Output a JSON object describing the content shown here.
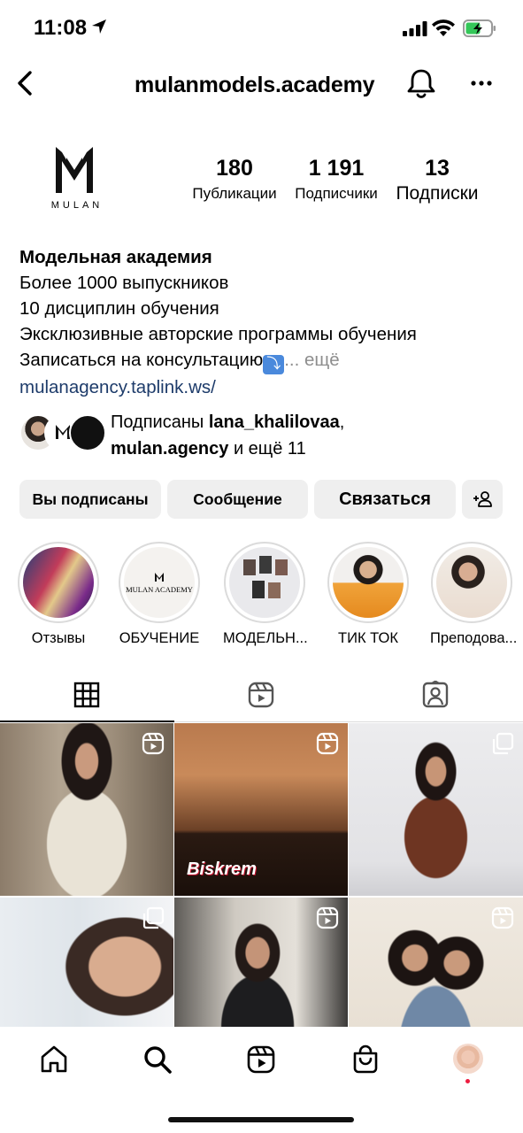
{
  "status_bar": {
    "time": "11:08"
  },
  "header": {
    "username": "mulanmodels.academy"
  },
  "avatar": {
    "logo_text": "MULAN"
  },
  "stats": [
    {
      "value": "180",
      "label": "Публикации"
    },
    {
      "value": "1 191",
      "label": "Подписчики"
    },
    {
      "value": "13",
      "label": "Подписки"
    }
  ],
  "bio": {
    "name": "Модельная академия",
    "lines": [
      "Более 1000 выпускников",
      "10 дисциплин обучения",
      "Эксклюзивные авторские программы обучения"
    ],
    "last_line": "Записаться на консультацию",
    "more": "... ещё",
    "link": "mulanagency.taplink.ws/"
  },
  "followed_by": {
    "prefix": "Подписаны ",
    "user1": "lana_khalilovaa",
    "sep": ",",
    "user2": "mulan.agency",
    "suffix": " и ещё 11"
  },
  "buttons": {
    "following": "Вы подписаны",
    "message": "Сообщение",
    "contact": "Связаться"
  },
  "highlights": [
    {
      "label": "Отзывы"
    },
    {
      "label": "ОБУЧЕНИЕ",
      "cover_text": "MULAN ACADEMY"
    },
    {
      "label": "МОДЕЛЬН..."
    },
    {
      "label": "ТИК ТОК"
    },
    {
      "label": "Преподова..."
    }
  ],
  "posts": [
    {
      "type": "reel"
    },
    {
      "type": "reel",
      "caption": "Biskrem"
    },
    {
      "type": "carousel"
    },
    {
      "type": "carousel"
    },
    {
      "type": "reel"
    },
    {
      "type": "reel"
    }
  ]
}
